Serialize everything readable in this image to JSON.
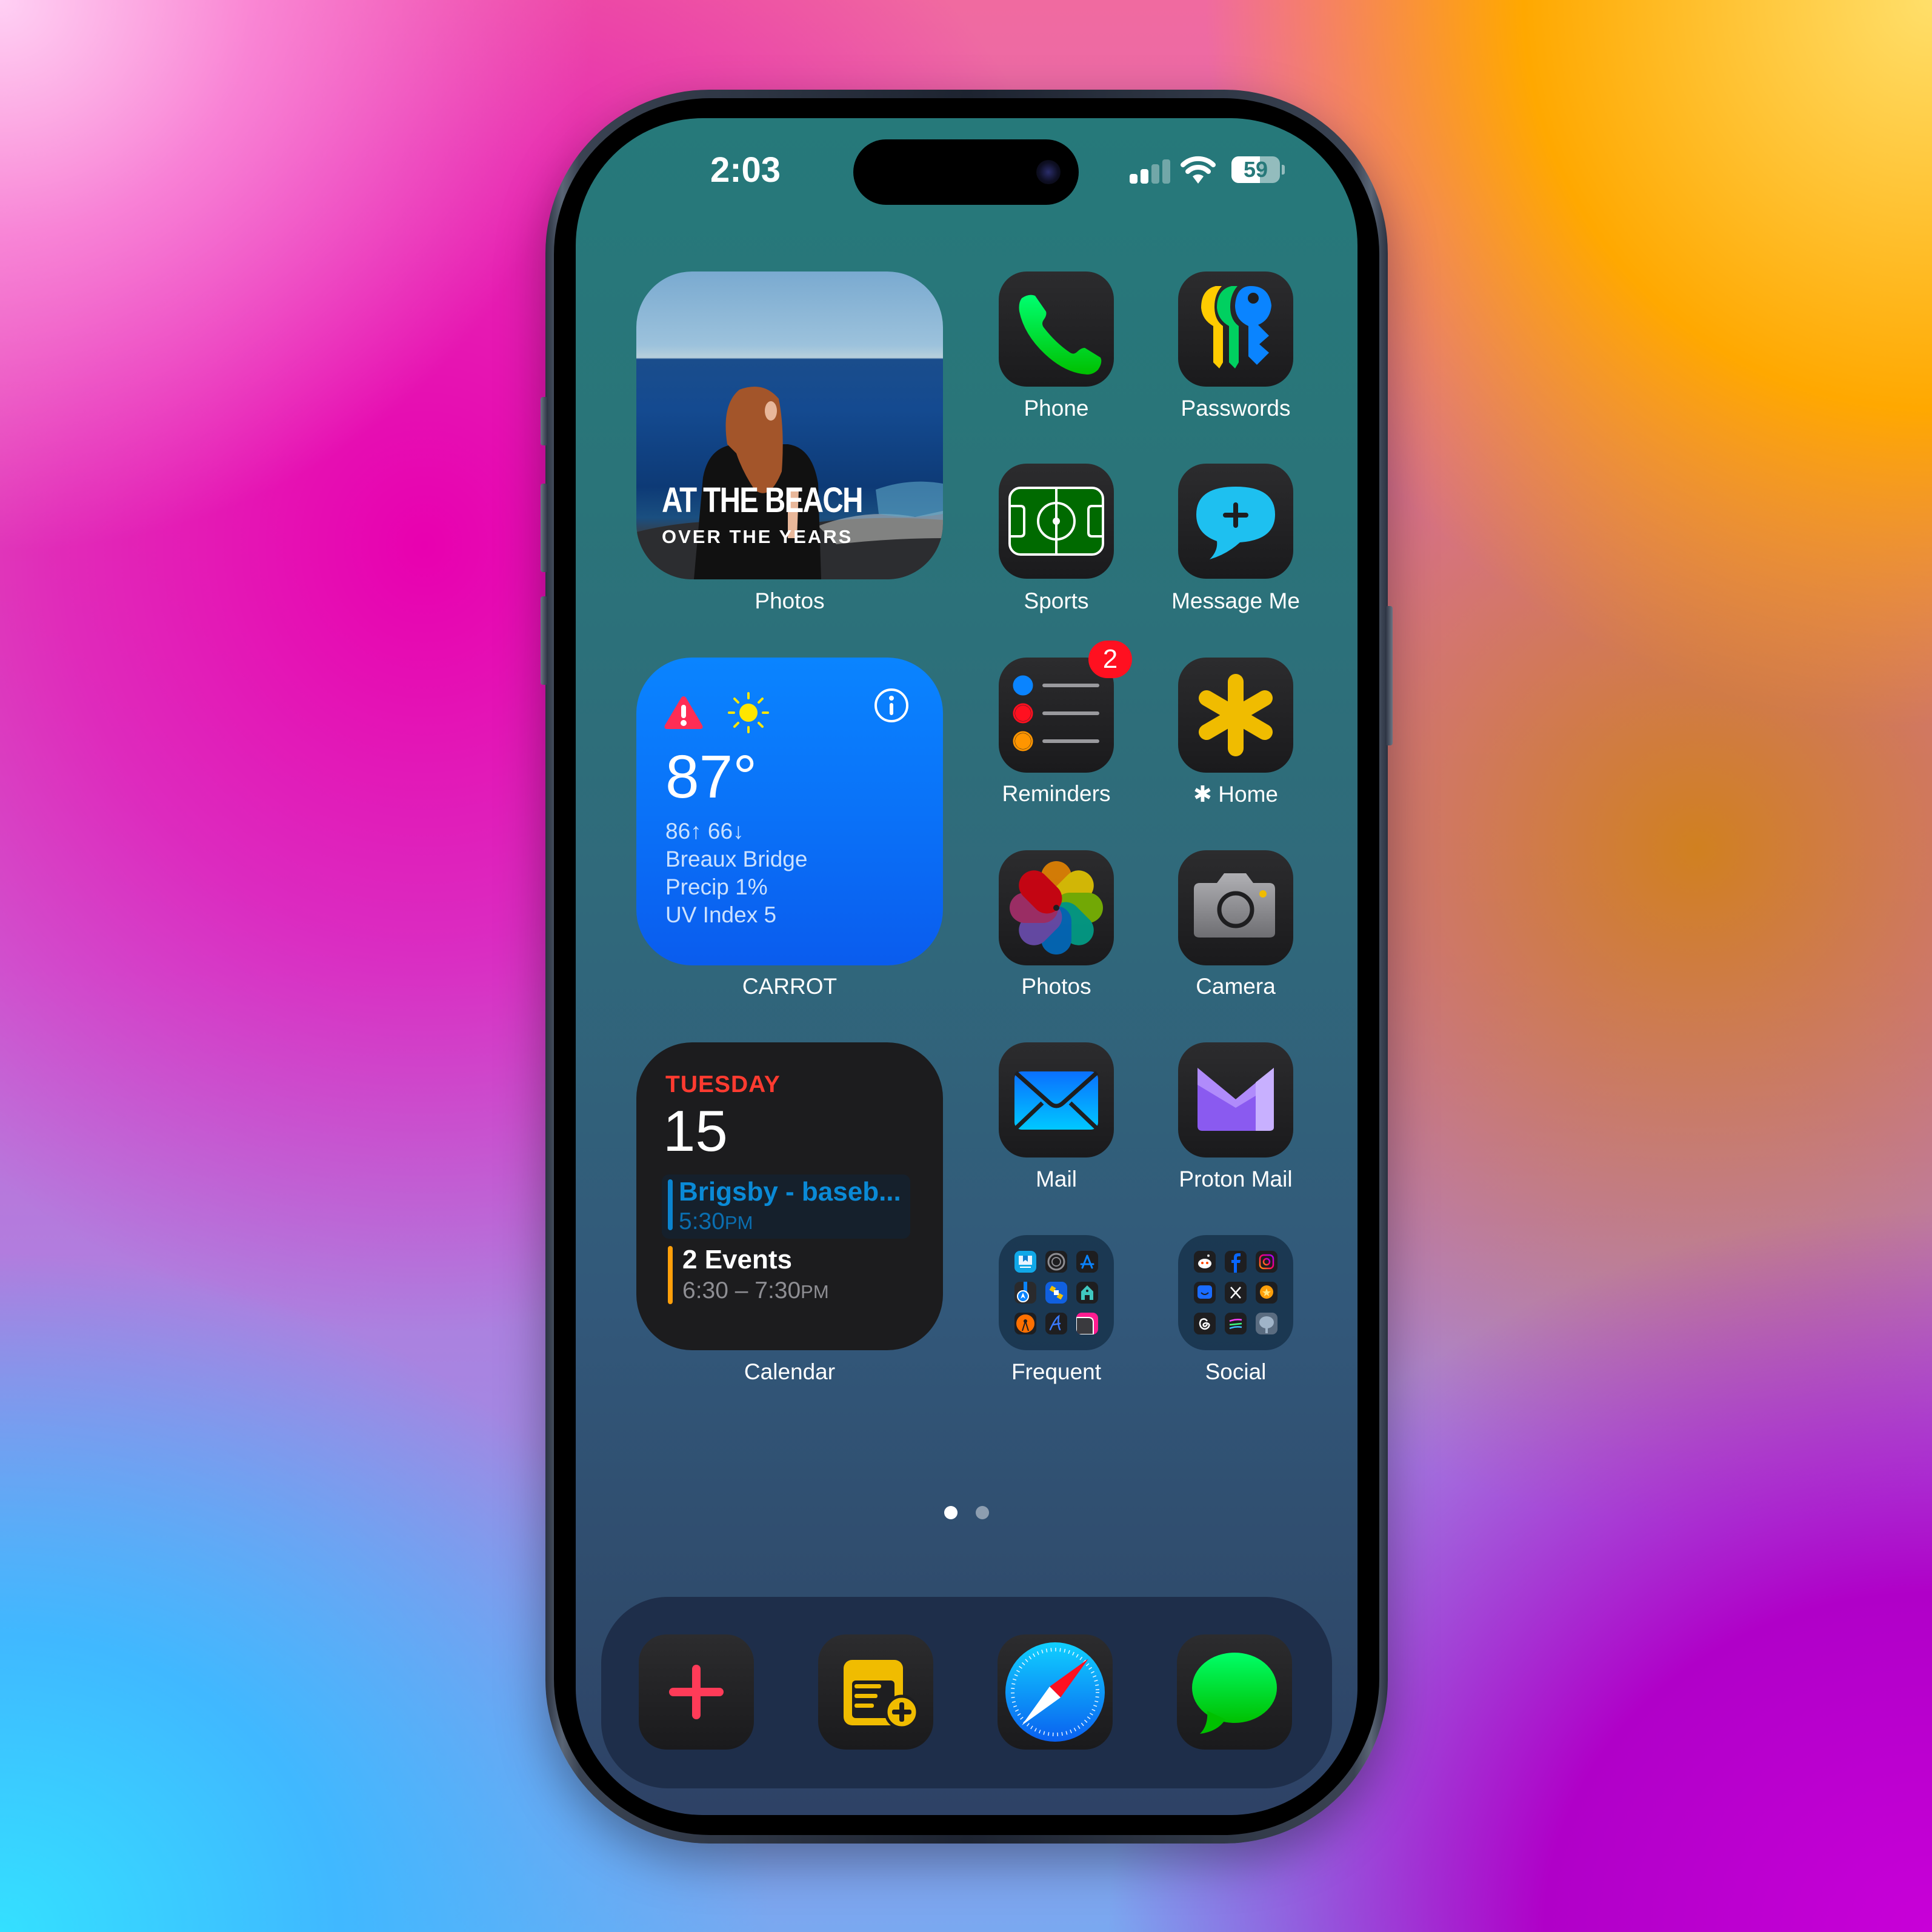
{
  "status_bar": {
    "time": "2:03",
    "signal_bars_filled": 2,
    "signal_bars_total": 4,
    "wifi_icon": "wifi-icon",
    "battery_percent": 59,
    "battery_label": "59"
  },
  "widgets": {
    "photos": {
      "title": "AT THE BEACH",
      "subtitle": "OVER THE YEARS",
      "label": "Photos"
    },
    "weather": {
      "alert_icon": "warning-triangle-icon",
      "condition_icon": "sun-icon",
      "info_icon": "info-icon",
      "temperature": "87°",
      "high_low": "86↑ 66↓",
      "location": "Breaux Bridge",
      "precip": "Precip 1%",
      "uv": "UV Index 5",
      "label": "CARROT"
    },
    "calendar": {
      "weekday": "TUESDAY",
      "date": "15",
      "events": [
        {
          "title": "Brigsby - baseb...",
          "time": "5:30",
          "suffix": "PM",
          "color": "#0a84d0"
        },
        {
          "title": "2 Events",
          "time": "6:30 – 7:30",
          "suffix": "PM",
          "color": "#ff9f0a"
        }
      ],
      "label": "Calendar"
    }
  },
  "apps": [
    {
      "name": "Phone",
      "icon": "phone-icon"
    },
    {
      "name": "Passwords",
      "icon": "keys-icon"
    },
    {
      "name": "Sports",
      "icon": "soccer-field-icon"
    },
    {
      "name": "Message Me",
      "icon": "chat-plus-icon"
    },
    {
      "name": "Reminders",
      "icon": "reminders-list-icon",
      "badge": "2"
    },
    {
      "name": "✱ Home",
      "icon": "asterisk-icon"
    },
    {
      "name": "Photos",
      "icon": "photos-flower-icon"
    },
    {
      "name": "Camera",
      "icon": "camera-icon"
    },
    {
      "name": "Mail",
      "icon": "envelope-icon"
    },
    {
      "name": "Proton Mail",
      "icon": "proton-mail-icon"
    }
  ],
  "folders": [
    {
      "name": "Frequent",
      "apps": [
        "screen-share-icon",
        "settings-gear-icon",
        "app-store-icon",
        "maps-nav-icon",
        "satellite-icon",
        "home-app-icon",
        "overcast-podcast-icon",
        "script-a-icon",
        "wallpaper-icon"
      ]
    },
    {
      "name": "Social",
      "apps": [
        "reddit-icon",
        "facebook-icon",
        "instagram-icon",
        "groupme-icon",
        "x-icon",
        "star-chat-icon",
        "threads-icon",
        "feeds-icon",
        "mastodon-elephant-icon"
      ]
    }
  ],
  "page_indicator": {
    "current": 1,
    "total": 2
  },
  "dock": [
    {
      "icon": "plus-icon",
      "name": "Add"
    },
    {
      "icon": "note-add-icon",
      "name": "Notes Add"
    },
    {
      "icon": "safari-compass-icon",
      "name": "Safari"
    },
    {
      "icon": "messages-bubble-icon",
      "name": "Messages"
    }
  ],
  "colors": {
    "weather_bg": "#0a84ff",
    "calendar_weekday": "#ff3b30",
    "badge": "#ff1020",
    "dock_bg": "#1e2e4a"
  }
}
